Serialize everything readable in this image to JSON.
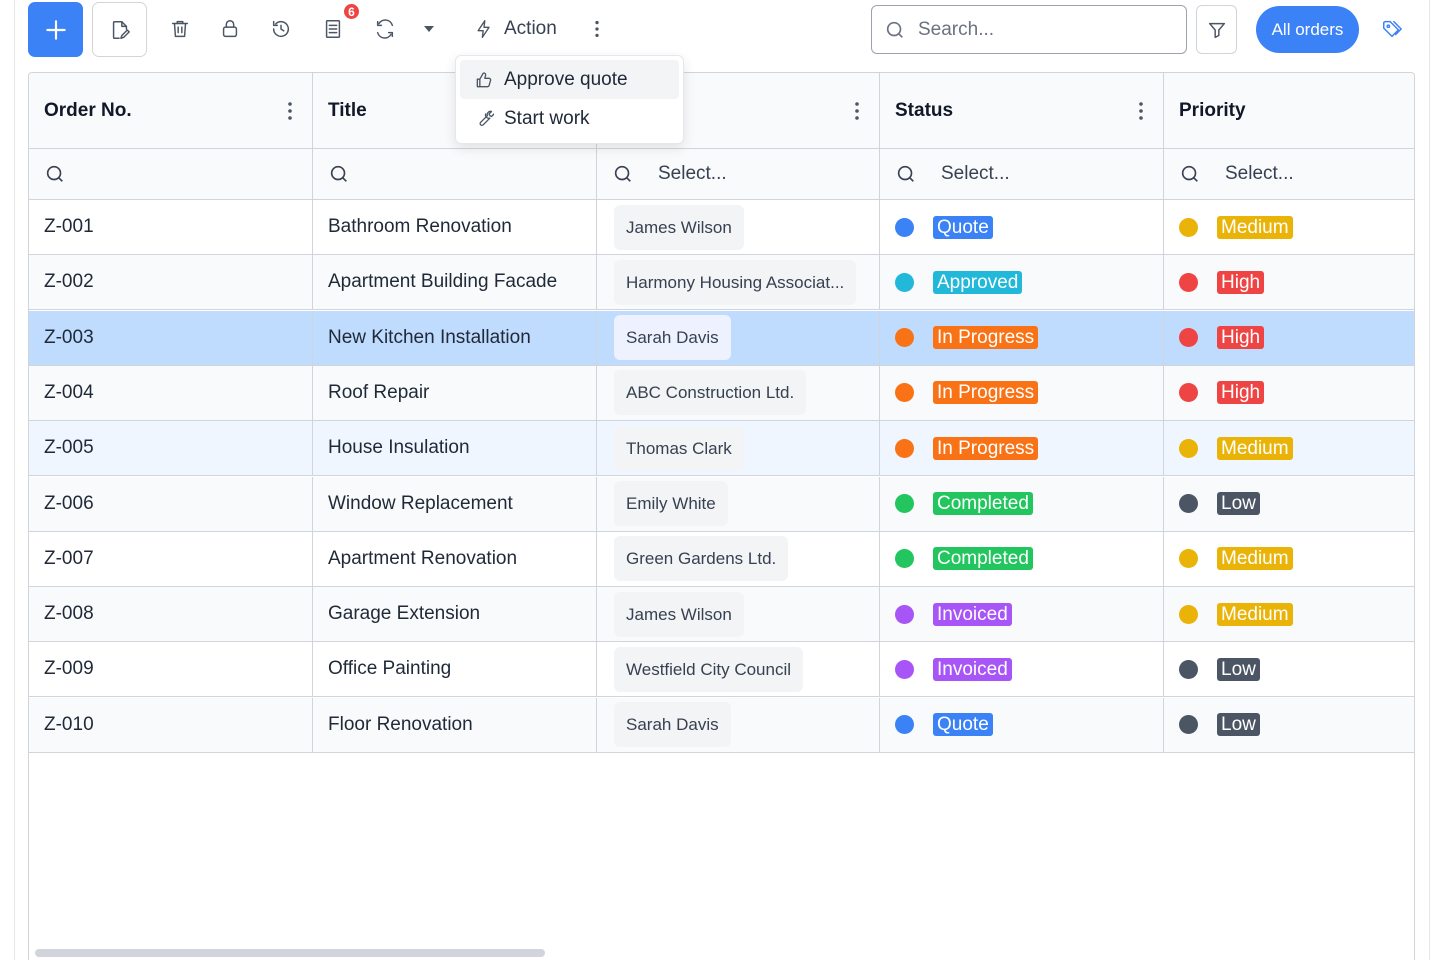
{
  "toolbar": {
    "add_icon": "plus-icon",
    "edit_icon": "edit-document-icon",
    "delete_icon": "trash-icon",
    "lock_icon": "lock-icon",
    "history_icon": "history-icon",
    "document_icon": "document-list-icon",
    "document_badge": "6",
    "refresh_icon": "refresh-icon",
    "caret_icon": "caret-down-icon",
    "action_label": "Action",
    "more_icon": "more-vertical-icon",
    "search_placeholder": "Search...",
    "filter_icon": "filter-icon",
    "all_orders_label": "All orders",
    "tag_icon": "tag-icon",
    "accent_color": "#3b82f6"
  },
  "action_menu": {
    "items": [
      {
        "label": "Approve quote",
        "icon": "thumbs-up-icon"
      },
      {
        "label": "Start work",
        "icon": "wrench-icon"
      }
    ]
  },
  "table": {
    "columns": [
      {
        "label": "Order No."
      },
      {
        "label": "Title"
      },
      {
        "label": ""
      },
      {
        "label": "Status"
      },
      {
        "label": "Priority"
      }
    ],
    "filters": [
      "",
      "",
      "Select...",
      "Select...",
      "Select..."
    ],
    "rows": [
      {
        "order": "Z-001",
        "title": "Bathroom Renovation",
        "customer": "James Wilson",
        "status": "Quote",
        "priority": "Medium"
      },
      {
        "order": "Z-002",
        "title": "Apartment Building Facade",
        "customer": "Harmony Housing Associat...",
        "status": "Approved",
        "priority": "High"
      },
      {
        "order": "Z-003",
        "title": "New Kitchen Installation",
        "customer": "Sarah Davis",
        "status": "In Progress",
        "priority": "High"
      },
      {
        "order": "Z-004",
        "title": "Roof Repair",
        "customer": "ABC Construction Ltd.",
        "status": "In Progress",
        "priority": "High"
      },
      {
        "order": "Z-005",
        "title": "House Insulation",
        "customer": "Thomas Clark",
        "status": "In Progress",
        "priority": "Medium"
      },
      {
        "order": "Z-006",
        "title": "Window Replacement",
        "customer": "Emily White",
        "status": "Completed",
        "priority": "Low"
      },
      {
        "order": "Z-007",
        "title": "Apartment Renovation",
        "customer": "Green Gardens Ltd.",
        "status": "Completed",
        "priority": "Medium"
      },
      {
        "order": "Z-008",
        "title": "Garage Extension",
        "customer": "James Wilson",
        "status": "Invoiced",
        "priority": "Medium"
      },
      {
        "order": "Z-009",
        "title": "Office Painting",
        "customer": "Westfield City Council",
        "status": "Invoiced",
        "priority": "Low"
      },
      {
        "order": "Z-010",
        "title": "Floor Renovation",
        "customer": "Sarah Davis",
        "status": "Quote",
        "priority": "Low"
      }
    ],
    "selected_order": "Z-003",
    "hovered_order": "Z-005"
  },
  "status_colors": {
    "Quote": "#3b82f6",
    "Approved": "#22b8d9",
    "In Progress": "#f97316",
    "Completed": "#22c55e",
    "Invoiced": "#a855f7"
  },
  "priority_colors": {
    "High": "#ef4444",
    "Medium": "#eab308",
    "Low": "#4b5563"
  }
}
